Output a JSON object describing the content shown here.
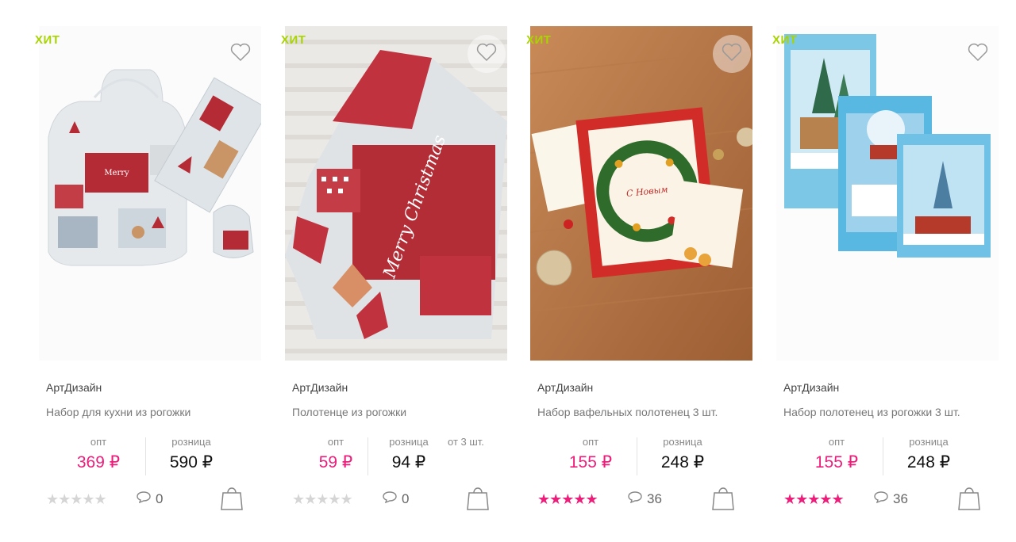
{
  "products": [
    {
      "badge": "ХИТ",
      "brand": "АртДизайн",
      "title": "Набор для кухни из рогожки",
      "opt_label": "опт",
      "opt_price": "369 ₽",
      "retail_label": "розница",
      "retail_price": "590 ₽",
      "min_qty": "",
      "rating": 0,
      "comments": "0"
    },
    {
      "badge": "ХИТ",
      "brand": "АртДизайн",
      "title": "Полотенце из рогожки",
      "opt_label": "опт",
      "opt_price": "59 ₽",
      "retail_label": "розница",
      "retail_price": "94 ₽",
      "min_qty": "от 3 шт.",
      "rating": 0,
      "comments": "0"
    },
    {
      "badge": "ХИТ",
      "brand": "АртДизайн",
      "title": "Набор вафельных полотенец 3 шт.",
      "opt_label": "опт",
      "opt_price": "155 ₽",
      "retail_label": "розница",
      "retail_price": "248 ₽",
      "min_qty": "",
      "rating": 5,
      "comments": "36"
    },
    {
      "badge": "ХИТ",
      "brand": "АртДизайн",
      "title": "Набор полотенец из рогожки 3 шт.",
      "opt_label": "опт",
      "opt_price": "155 ₽",
      "retail_label": "розница",
      "retail_price": "248 ₽",
      "min_qty": "",
      "rating": 5,
      "comments": "36"
    }
  ],
  "icons": {
    "favorite": "heart-outline-icon",
    "comments": "speech-bubble-icon",
    "cart": "shopping-bag-icon",
    "rating": "star-icon"
  },
  "colors": {
    "badge": "#a8d400",
    "opt_price": "#ec1e7a",
    "stars_active": "#ec1e7a",
    "stars_inactive": "#d5d5d5"
  }
}
